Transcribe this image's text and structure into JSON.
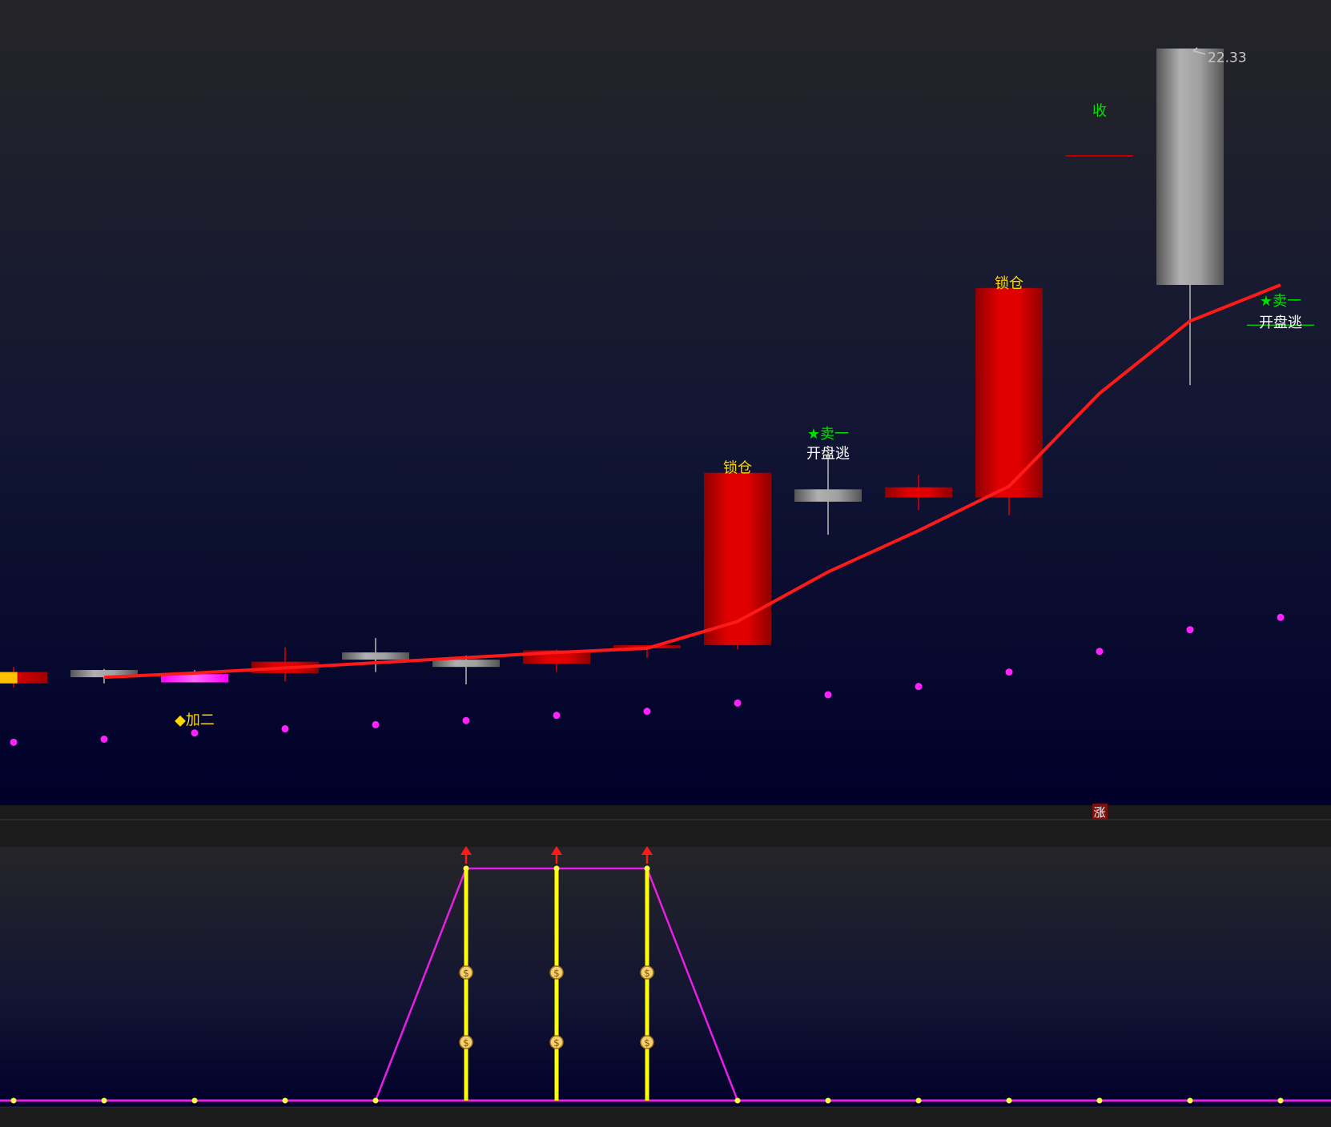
{
  "colors": {
    "up": "#d90000",
    "down": "#9a9a9a",
    "ma": "#ff1a1a",
    "dot": "#ff22ff",
    "label_yellow": "#ffd700",
    "label_green": "#00e000",
    "label_white": "#ffffff",
    "sub_line": "#e61ee6",
    "sub_bar": "#ffff00",
    "arrow": "#ff1a1a",
    "bg_top": "#252528",
    "bg_bottom": "#000026"
  },
  "chart_data": [
    {
      "type": "candlestick",
      "price_label": "22.33",
      "candles": [
        {
          "index": 0,
          "open": 16.18,
          "close": 16.29,
          "high": 16.34,
          "low": 16.14,
          "color": "#ffc000"
        },
        {
          "index": 1,
          "open": 16.31,
          "close": 16.24,
          "high": 16.32,
          "low": 16.18,
          "color": "#9a9a9a"
        },
        {
          "index": 2,
          "open": 16.19,
          "close": 16.27,
          "high": 16.31,
          "low": 16.19,
          "color": "#ff44ff"
        },
        {
          "index": 3,
          "open": 16.28,
          "close": 16.39,
          "high": 16.53,
          "low": 16.2,
          "color": "#d90000"
        },
        {
          "index": 4,
          "open": 16.48,
          "close": 16.41,
          "high": 16.62,
          "low": 16.29,
          "color": "#9a9a9a"
        },
        {
          "index": 5,
          "open": 16.41,
          "close": 16.34,
          "high": 16.45,
          "low": 16.17,
          "color": "#9a9a9a"
        },
        {
          "index": 6,
          "open": 16.37,
          "close": 16.5,
          "high": 16.51,
          "low": 16.29,
          "color": "#d90000"
        },
        {
          "index": 7,
          "open": 16.54,
          "close": 16.55,
          "high": 16.55,
          "low": 16.43,
          "color": "#d90000"
        },
        {
          "index": 8,
          "open": 16.55,
          "close": 18.22,
          "high": 18.22,
          "low": 16.51,
          "color": "#d90000"
        },
        {
          "index": 9,
          "open": 18.06,
          "close": 17.94,
          "high": 18.41,
          "low": 17.62,
          "color": "#9a9a9a"
        },
        {
          "index": 10,
          "open": 17.98,
          "close": 18.08,
          "high": 18.2,
          "low": 17.86,
          "color": "#d90000"
        },
        {
          "index": 11,
          "open": 17.98,
          "close": 20.01,
          "high": 20.01,
          "low": 17.81,
          "color": "#d90000"
        },
        {
          "index": 13,
          "open": 22.33,
          "close": 20.04,
          "high": 22.33,
          "low": 19.07,
          "color": "#9a9a9a"
        }
      ],
      "ma_line": [
        {
          "index": 1,
          "value": 16.24
        },
        {
          "index": 2,
          "value": 16.28
        },
        {
          "index": 6,
          "value": 16.48
        },
        {
          "index": 7,
          "value": 16.52
        },
        {
          "index": 8,
          "value": 16.78
        },
        {
          "index": 9,
          "value": 17.26
        },
        {
          "index": 10,
          "value": 17.66
        },
        {
          "index": 11,
          "value": 18.09
        },
        {
          "index": 12,
          "value": 18.99
        },
        {
          "index": 13,
          "value": 19.69
        },
        {
          "index": 14,
          "value": 20.04
        }
      ],
      "dots": [
        {
          "index": 0,
          "value": 15.61
        },
        {
          "index": 1,
          "value": 15.64
        },
        {
          "index": 2,
          "value": 15.7
        },
        {
          "index": 3,
          "value": 15.74
        },
        {
          "index": 4,
          "value": 15.78
        },
        {
          "index": 5,
          "value": 15.82
        },
        {
          "index": 6,
          "value": 15.87
        },
        {
          "index": 7,
          "value": 15.91
        },
        {
          "index": 8,
          "value": 15.99
        },
        {
          "index": 9,
          "value": 16.07
        },
        {
          "index": 10,
          "value": 16.15
        },
        {
          "index": 11,
          "value": 16.29
        },
        {
          "index": 12,
          "value": 16.49
        },
        {
          "index": 13,
          "value": 16.7
        },
        {
          "index": 14,
          "value": 16.82
        }
      ],
      "annotations": [
        {
          "text": "◆加二",
          "index": 2,
          "value": 15.78,
          "color": "yellow"
        },
        {
          "text": "锁仓",
          "index": 8,
          "value": 18.22,
          "color": "yellow"
        },
        {
          "text": "★卖一",
          "index": 9,
          "value": 18.55,
          "color": "green"
        },
        {
          "text": "开盘逃",
          "index": 9,
          "value": 18.36,
          "color": "white"
        },
        {
          "text": "锁仓",
          "index": 11,
          "value": 20.01,
          "color": "yellow"
        },
        {
          "text": "收",
          "index": 12,
          "value": 21.68,
          "color": "green"
        },
        {
          "text": "★卖一",
          "index": 14,
          "value": 19.84,
          "color": "green"
        },
        {
          "text": "开盘逃",
          "index": 14,
          "value": 19.63,
          "color": "white"
        }
      ],
      "marks": [
        {
          "type": "tick",
          "index": 12,
          "value": 21.29,
          "color": "red"
        },
        {
          "type": "tick",
          "index": 14,
          "value": 19.65,
          "color": "green"
        }
      ]
    },
    {
      "type": "line",
      "values": [
        0,
        0,
        0,
        0,
        0,
        1,
        1,
        1,
        0,
        0,
        0,
        0,
        0,
        0,
        0
      ],
      "signal_bars": [
        5,
        6,
        7
      ],
      "up_arrows": [
        5,
        6,
        7
      ]
    }
  ],
  "badge": {
    "text": "涨",
    "index": 12
  }
}
